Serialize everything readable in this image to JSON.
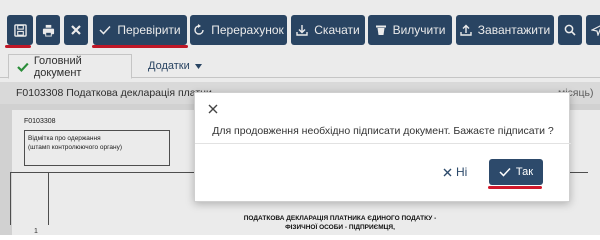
{
  "toolbar": {
    "save_icon": "floppy-disk-icon",
    "print_icon": "printer-icon",
    "close_icon": "close-icon",
    "check_label": "Перевірити",
    "recalc_label": "Перерахунок",
    "download_label": "Скачати",
    "delete_label": "Вилучити",
    "upload_label": "Завантажити",
    "search_icon": "search-icon",
    "send_icon": "send-icon"
  },
  "tabs": {
    "main_label": "Головний документ",
    "attachments_label": "Додатки"
  },
  "document": {
    "title": "F0103308 Податкова декларація платни",
    "title_tail": "місяць)",
    "form_code": "F0103308",
    "stamp_line1": "Відмітка про одержання",
    "stamp_line2": "(штамп контролюючого органу)",
    "row_number": "1",
    "decl_title_line1": "ПОДАТКОВА ДЕКЛАРАЦІЯ ПЛАТНИКА ЄДИНОГО ПОДАТКУ -",
    "decl_title_line2": "ФІЗИЧНОЇ ОСОБИ - ПІДПРИЄМЦЯ,"
  },
  "dialog": {
    "message": "Для продовження необхідно підписати документ. Бажаєте підписати ?",
    "no_label": "Ні",
    "yes_label": "Так"
  },
  "colors": {
    "primary": "#2d4a6b",
    "highlight": "#d1192b",
    "check_green": "#2e9a3e"
  }
}
